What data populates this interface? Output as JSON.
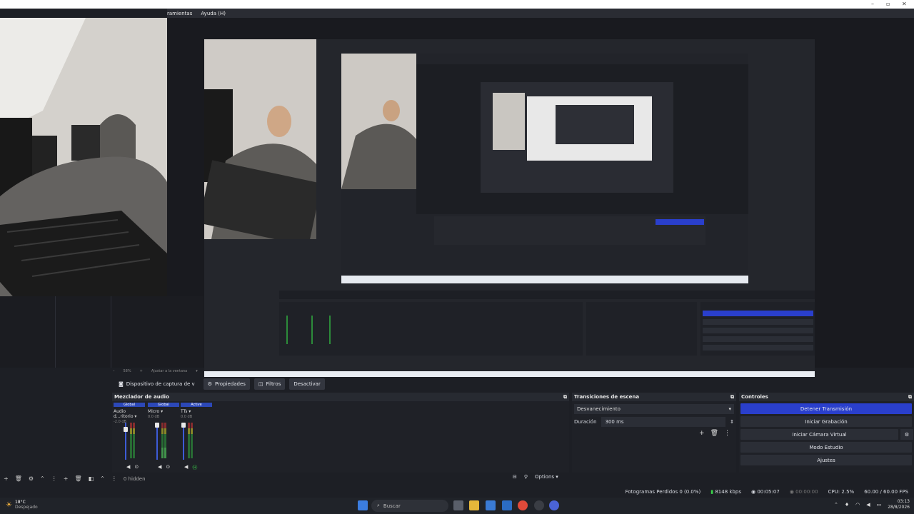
{
  "menu": {
    "items": [
      "ramientas",
      "Ayuda (H)"
    ]
  },
  "source_toolbar": {
    "source": "Dispositivo de captura de v",
    "properties": "Propiedades",
    "filters": "Filtros",
    "deactivate": "Desactivar"
  },
  "zoom": {
    "percent": "58%",
    "fit": "Ajustar a la ventana"
  },
  "mixer": {
    "title": "Mezclador de audio",
    "channels": [
      {
        "tag": "Global",
        "name": "Audio d...ritorio",
        "db": "-2.0 dB",
        "level": 0.0
      },
      {
        "tag": "Global",
        "name": "Micro",
        "db": "0.0 dB",
        "level": 0.3
      },
      {
        "tag": "Active",
        "name": "TTs",
        "db": "0.0 dB",
        "level": 0.0
      }
    ],
    "options": "Options"
  },
  "transitions": {
    "title": "Transiciones de escena",
    "selected": "Desvanecimiento",
    "duration_label": "Duración",
    "duration_value": "300 ms"
  },
  "controls": {
    "title": "Controles",
    "stop_stream": "Detener Transmisión",
    "start_record": "Iniciar Grabación",
    "virtual_cam": "Iniciar Cámara Virtual",
    "studio_mode": "Modo Estudio",
    "settings": "Ajustes"
  },
  "scenes_footer": {
    "hidden": "0 hidden"
  },
  "status": {
    "dropped": "Fotogramas Perdidos 0 (0.0%)",
    "kbps": "8148 kbps",
    "live_time": "00:05:07",
    "rec_time": "00:00:00",
    "cpu": "CPU: 2.5%",
    "fps": "60.00 / 60.00 FPS"
  },
  "taskbar": {
    "temp": "18°C",
    "weather": "Despejado",
    "search": "Buscar",
    "time": "03:13",
    "date": "28/8/2026"
  },
  "colors": {
    "accent": "#2a3fcc",
    "panel": "#1f2127"
  }
}
